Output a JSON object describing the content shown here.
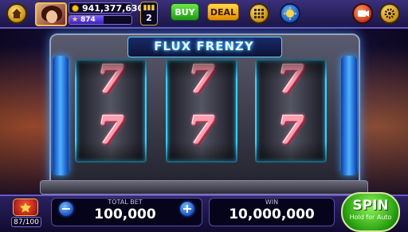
{
  "top_bar": {
    "coins": "941,377,630",
    "xp_value": "874",
    "xp_progress_fraction": 0.55,
    "level": "2",
    "buy_label": "BUY",
    "deal_label": "DEAL"
  },
  "machine": {
    "title": "FLUX FRENZY",
    "reels": [
      {
        "symbols": [
          "7",
          "7"
        ]
      },
      {
        "symbols": [
          "7",
          "7"
        ]
      },
      {
        "symbols": [
          "7",
          "7"
        ]
      }
    ]
  },
  "bottom_bar": {
    "gift_count": "87/100",
    "total_bet_label": "TOTAL BET",
    "total_bet": "100,000",
    "minus_label": "−",
    "plus_label": "+",
    "win_label": "WIN",
    "win": "10,000,000",
    "spin_label": "SPIN",
    "spin_sub": "Hold for Auto"
  },
  "colors": {
    "accent_frame": "#3ad0ff",
    "buy": "#1e9a16",
    "deal": "#e08a00",
    "spin": "#2ea614"
  },
  "icons": [
    "home-icon",
    "coin-icon",
    "star-icon",
    "level-badge-icon",
    "grid-menu-icon",
    "globe-icon",
    "video-icon",
    "gear-icon",
    "gift-icon"
  ]
}
